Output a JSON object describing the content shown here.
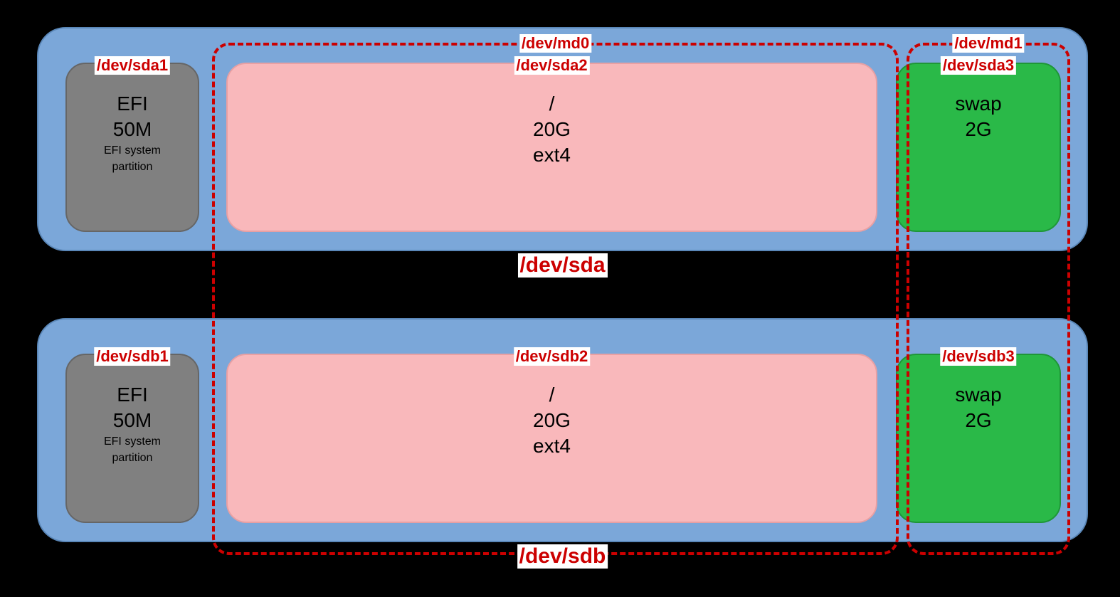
{
  "raid": {
    "md0": {
      "label": "/dev/md0"
    },
    "md1": {
      "label": "/dev/md1"
    }
  },
  "disks": [
    {
      "name": "/dev/sda",
      "parts": [
        {
          "dev": "/dev/sda1",
          "title": "EFI",
          "size": "50M",
          "fs1": "EFI system",
          "fs2": "partition",
          "type": "efi"
        },
        {
          "dev": "/dev/sda2",
          "title": "/",
          "size": "20G",
          "fs1": "ext4",
          "fs2": "",
          "type": "root"
        },
        {
          "dev": "/dev/sda3",
          "title": "swap",
          "size": "2G",
          "fs1": "",
          "fs2": "",
          "type": "swap"
        }
      ]
    },
    {
      "name": "/dev/sdb",
      "parts": [
        {
          "dev": "/dev/sdb1",
          "title": "EFI",
          "size": "50M",
          "fs1": "EFI system",
          "fs2": "partition",
          "type": "efi"
        },
        {
          "dev": "/dev/sdb2",
          "title": "/",
          "size": "20G",
          "fs1": "ext4",
          "fs2": "",
          "type": "root"
        },
        {
          "dev": "/dev/sdb3",
          "title": "swap",
          "size": "2G",
          "fs1": "",
          "fs2": "",
          "type": "swap"
        }
      ]
    }
  ]
}
